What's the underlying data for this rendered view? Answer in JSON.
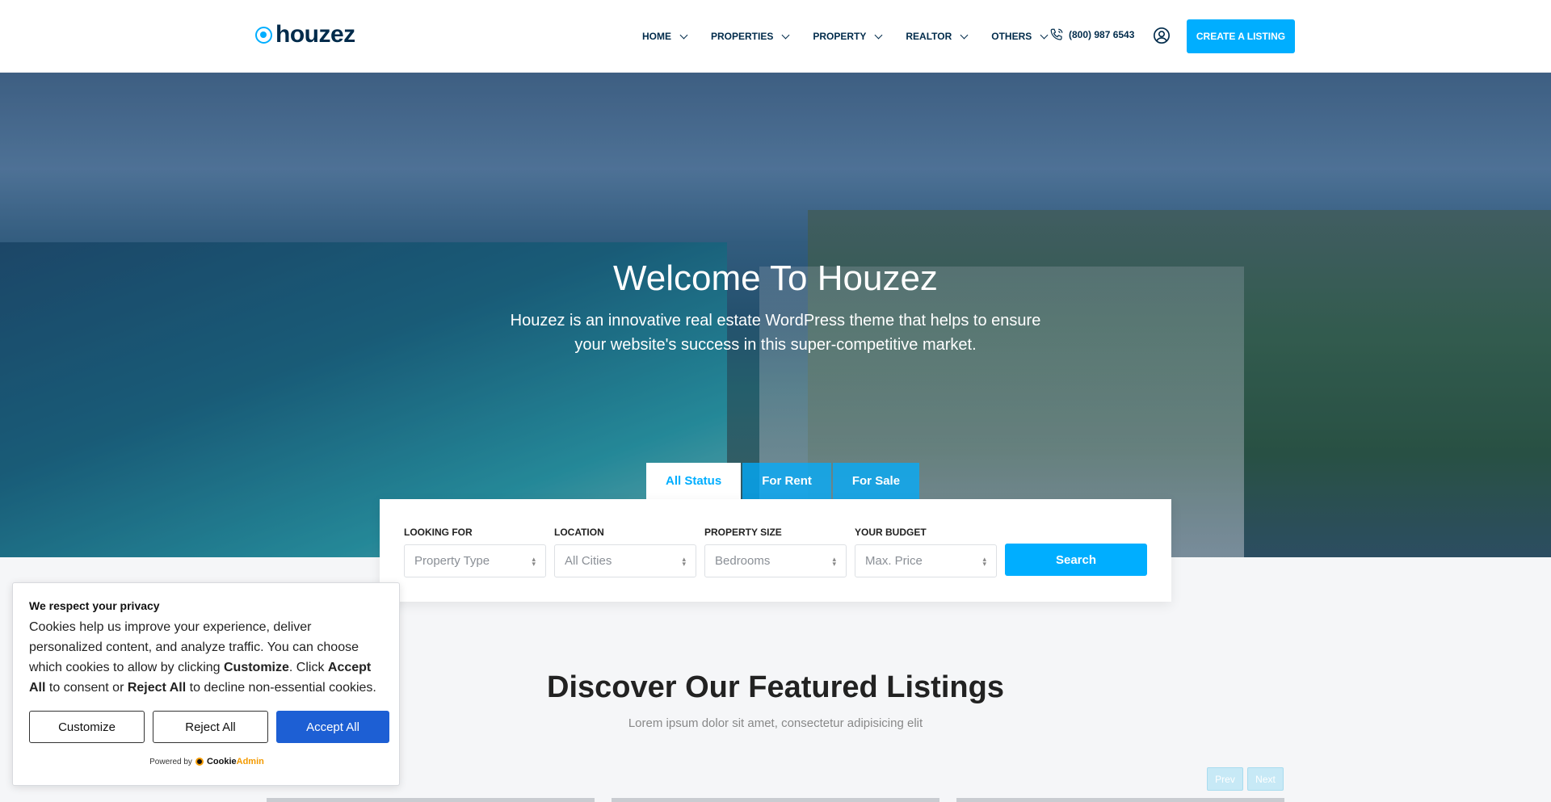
{
  "header": {
    "logo_text": "houzez",
    "nav": [
      "HOME",
      "PROPERTIES",
      "PROPERTY",
      "REALTOR",
      "OTHERS"
    ],
    "phone": "(800) 987 6543",
    "create_label": "CREATE A LISTING"
  },
  "hero": {
    "title": "Welcome To Houzez",
    "subtitle": "Houzez is an innovative real estate WordPress theme that helps to ensure your website's success in this super-competitive market."
  },
  "search": {
    "tabs": [
      "All Status",
      "For Rent",
      "For Sale"
    ],
    "active_tab": "All Status",
    "fields": [
      {
        "label": "LOOKING FOR",
        "placeholder": "Property Type"
      },
      {
        "label": "LOCATION",
        "placeholder": "All Cities"
      },
      {
        "label": "PROPERTY SIZE",
        "placeholder": "Bedrooms"
      },
      {
        "label": "YOUR BUDGET",
        "placeholder": "Max. Price"
      }
    ],
    "button": "Search"
  },
  "featured": {
    "title": "Discover Our Featured Listings",
    "subtitle": "Lorem ipsum dolor sit amet, consectetur adipisicing elit",
    "prev": "Prev",
    "next": "Next"
  },
  "cookie": {
    "title": "We respect your privacy",
    "text_1": "Cookies help us improve your experience, deliver personalized content, and analyze traffic. You can choose which cookies to allow by clicking ",
    "customize_word": "Customize",
    "text_2": ". Click ",
    "accept_word": "Accept All",
    "text_3": " to consent or ",
    "reject_word": "Reject All",
    "text_4": " to decline non-essential cookies.",
    "buttons": [
      "Customize",
      "Reject All",
      "Accept All"
    ],
    "powered_by": "Powered by",
    "brand_a": "Cookie",
    "brand_b": "Admin"
  },
  "colors": {
    "accent": "#00aeff",
    "navy": "#002b4b",
    "accept": "#1d5fd4"
  },
  "icons": {
    "phone": "phone-icon",
    "user": "user-circle-icon",
    "chevron": "chevron-down-icon"
  }
}
